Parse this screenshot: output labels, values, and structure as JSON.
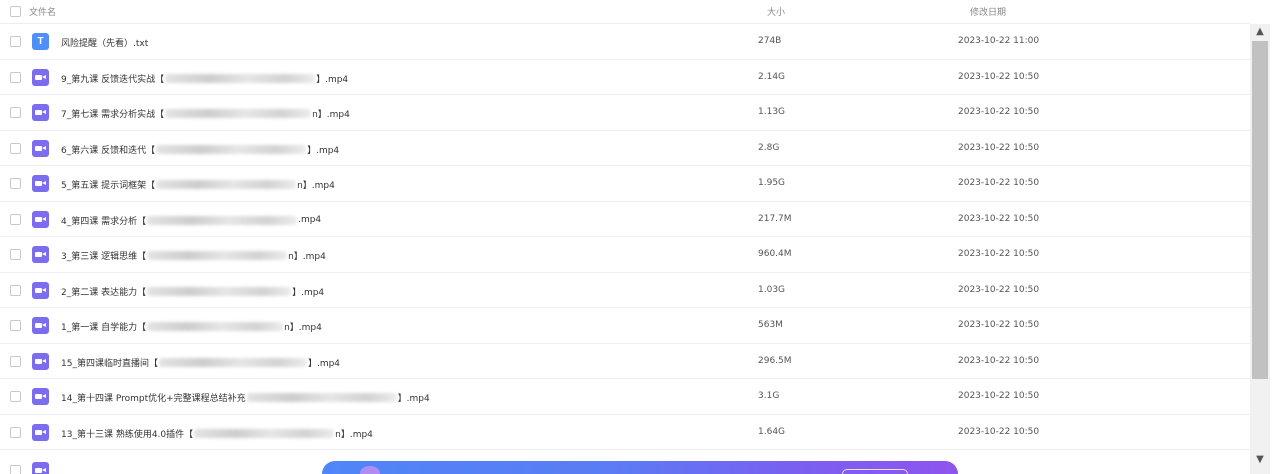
{
  "header": {
    "name_label": "文件名",
    "size_label": "大小",
    "date_label": "修改日期"
  },
  "files": [
    {
      "type": "txt",
      "name_prefix": "风险提醒（先看）.txt",
      "redact": 0,
      "name_suffix": "",
      "size": "274B",
      "date": "2023-10-22 11:00"
    },
    {
      "type": "video",
      "name_prefix": "9_第九课 反馈迭代实战【",
      "redact": 150,
      "name_suffix": "】.mp4",
      "size": "2.14G",
      "date": "2023-10-22 10:50"
    },
    {
      "type": "video",
      "name_prefix": "7_第七课 需求分析实战【",
      "redact": 146,
      "name_suffix": "n】.mp4",
      "size": "1.13G",
      "date": "2023-10-22 10:50"
    },
    {
      "type": "video",
      "name_prefix": "6_第六课 反馈和迭代【",
      "redact": 150,
      "name_suffix": "】.mp4",
      "size": "2.8G",
      "date": "2023-10-22 10:50"
    },
    {
      "type": "video",
      "name_prefix": "5_第五课 提示词框架【",
      "redact": 140,
      "name_suffix": "n】.mp4",
      "size": "1.95G",
      "date": "2023-10-22 10:50"
    },
    {
      "type": "video",
      "name_prefix": "4_第四课 需求分析【",
      "redact": 150,
      "name_suffix": ".mp4",
      "size": "217.7M",
      "date": "2023-10-22 10:50"
    },
    {
      "type": "video",
      "name_prefix": "3_第三课 逻辑思维【",
      "redact": 140,
      "name_suffix": "n】.mp4",
      "size": "960.4M",
      "date": "2023-10-22 10:50"
    },
    {
      "type": "video",
      "name_prefix": "2_第二课 表达能力【",
      "redact": 144,
      "name_suffix": "】.mp4",
      "size": "1.03G",
      "date": "2023-10-22 10:50"
    },
    {
      "type": "video",
      "name_prefix": "1_第一课 自学能力【",
      "redact": 136,
      "name_suffix": "n】.mp4",
      "size": "563M",
      "date": "2023-10-22 10:50"
    },
    {
      "type": "video",
      "name_prefix": "15_第四课临时直播间【",
      "redact": 148,
      "name_suffix": "】.mp4",
      "size": "296.5M",
      "date": "2023-10-22 10:50"
    },
    {
      "type": "video",
      "name_prefix": "14_第十四课 Prompt优化+完整课程总结补充",
      "redact": 150,
      "name_suffix": "】.mp4",
      "size": "3.1G",
      "date": "2023-10-22 10:50"
    },
    {
      "type": "video",
      "name_prefix": "13_第十三课 熟练使用4.0插件【",
      "redact": 140,
      "name_suffix": "n】.mp4",
      "size": "1.64G",
      "date": "2023-10-22 10:50"
    }
  ]
}
